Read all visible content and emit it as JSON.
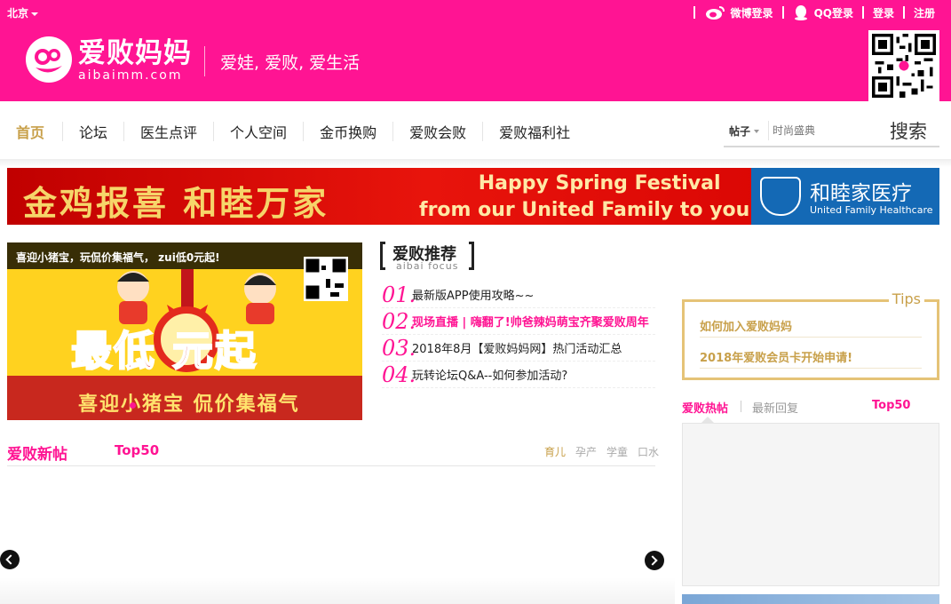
{
  "topbar": {
    "city": "北京",
    "weibo_login": "微博登录",
    "qq_login": "QQ登录",
    "login": "登录",
    "register": "注册"
  },
  "header": {
    "logo_cn": "爱败妈妈",
    "logo_en": "aibaimm.com",
    "slogan": "爱娃, 爱败, 爱生活"
  },
  "nav": {
    "items": [
      "首页",
      "论坛",
      "医生点评",
      "个人空间",
      "金币换购",
      "爱败会败",
      "爱败福利社"
    ],
    "active": "首页"
  },
  "search": {
    "type": "帖子",
    "placeholder": "时尚盛典",
    "button": "搜索"
  },
  "banner": {
    "cn_text": "金鸡报喜 和睦万家",
    "en_line1": "Happy Spring Festival",
    "en_line2": "from our United Family to yours!",
    "brand_cn": "和睦家医疗",
    "brand_en": "United Family Healthcare"
  },
  "slide": {
    "caption": "喜迎小猪宝，玩侃价集福气， zui低0元起!",
    "big_text": "最低  元起",
    "sub_text": "喜迎小猪宝 侃价集福气"
  },
  "recommend": {
    "title_cn": "爱败推荐",
    "title_en": "aibai focus",
    "items": [
      {
        "num": "01.",
        "text": "最新版APP使用攻略~~"
      },
      {
        "num": "02.",
        "text": "现场直播 | 嗨翻了!帅爸辣妈萌宝齐聚爱败周年"
      },
      {
        "num": "03.",
        "text": "2018年8月【爱败妈妈网】热门活动汇总"
      },
      {
        "num": "04.",
        "text": "玩转论坛Q&A--如何参加活动?"
      }
    ]
  },
  "new_posts": {
    "title": "爱败新帖",
    "top": "Top50",
    "tabs": [
      "育儿",
      "孕产",
      "学童",
      "口水"
    ],
    "active_tab": "育儿"
  },
  "tips": {
    "label": "Tips",
    "items": [
      "如何加入爱败妈妈",
      "2018年爱败会员卡开始申请!"
    ]
  },
  "hot": {
    "tab_hot": "爱败热帖",
    "tab_reply": "最新回复",
    "top": "Top50"
  },
  "colors": {
    "brand_pink": "#ff1493",
    "gold": "#c8a04a",
    "banner_red": "#e8140c",
    "brand_blue": "#1469b5"
  }
}
